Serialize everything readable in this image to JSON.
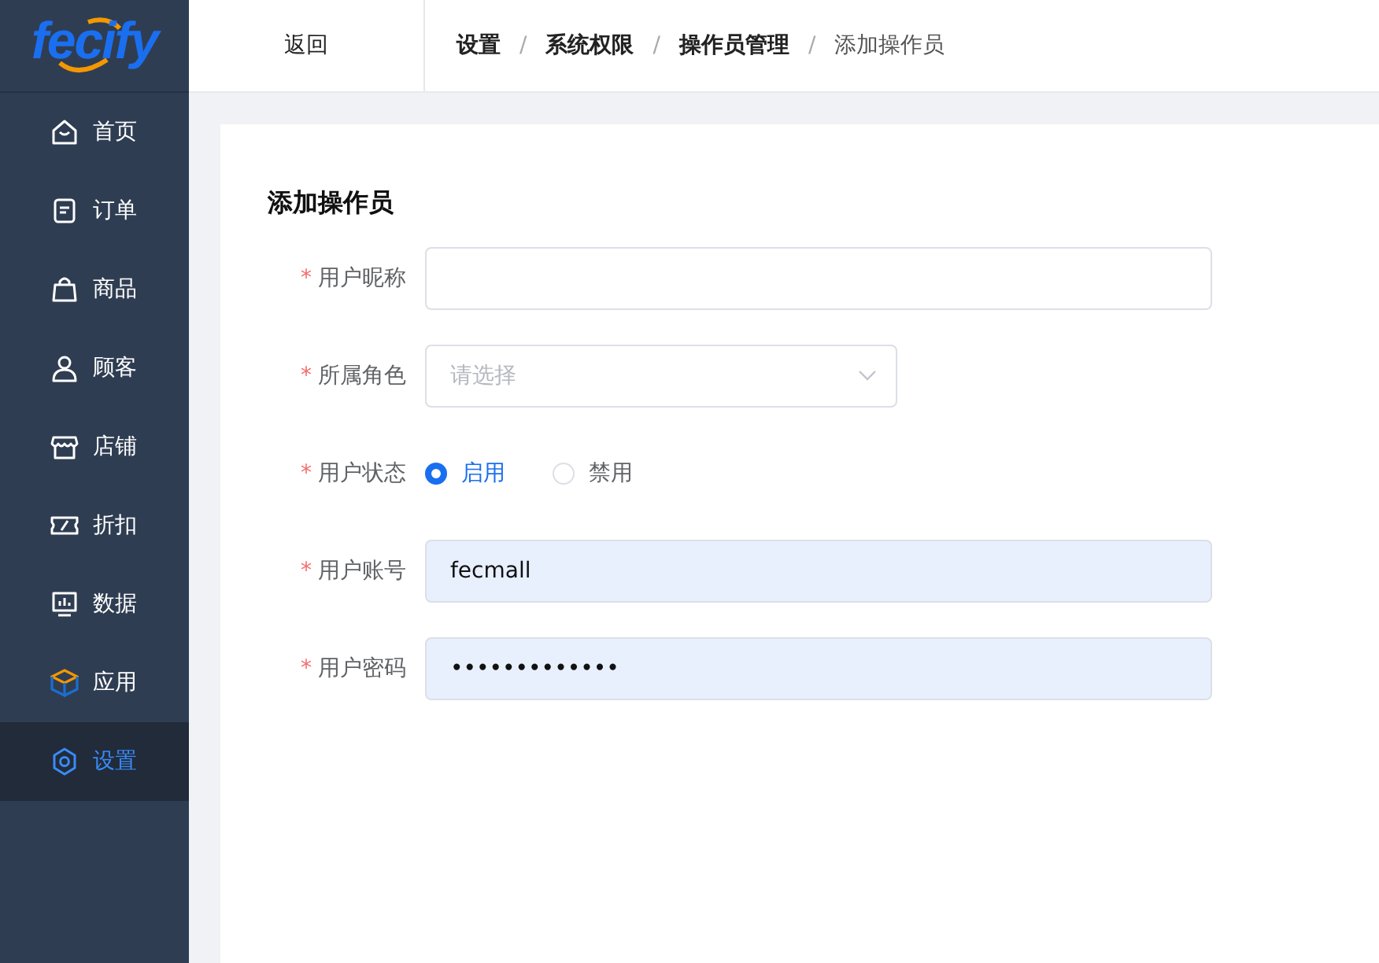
{
  "logo": "fecify",
  "sidebar": {
    "items": [
      {
        "label": "首页",
        "selected": false
      },
      {
        "label": "订单",
        "selected": false
      },
      {
        "label": "商品",
        "selected": false
      },
      {
        "label": "顾客",
        "selected": false
      },
      {
        "label": "店铺",
        "selected": false
      },
      {
        "label": "折扣",
        "selected": false
      },
      {
        "label": "数据",
        "selected": false
      },
      {
        "label": "应用",
        "selected": false
      },
      {
        "label": "设置",
        "selected": true
      }
    ]
  },
  "header": {
    "back": "返回",
    "breadcrumb": [
      "设置",
      "系统权限",
      "操作员管理",
      "添加操作员"
    ],
    "separator": "/"
  },
  "form": {
    "title": "添加操作员",
    "fields": [
      {
        "kind": "text",
        "label": "用户昵称",
        "required_mark": "*"
      },
      {
        "kind": "select",
        "label": "所属角色",
        "required_mark": "*",
        "placeholder": "请选择"
      },
      {
        "kind": "radio",
        "label": "用户状态",
        "required_mark": "*",
        "options": [
          {
            "label": "启用",
            "selected": true
          },
          {
            "label": "禁用",
            "selected": false
          }
        ]
      },
      {
        "kind": "text",
        "label": "用户账号",
        "required_mark": "*",
        "value": "fecmall",
        "autofilled": true
      },
      {
        "kind": "text",
        "label": "用户密码",
        "required_mark": "*",
        "value": "•••••••••••••",
        "autofilled": true
      }
    ]
  }
}
